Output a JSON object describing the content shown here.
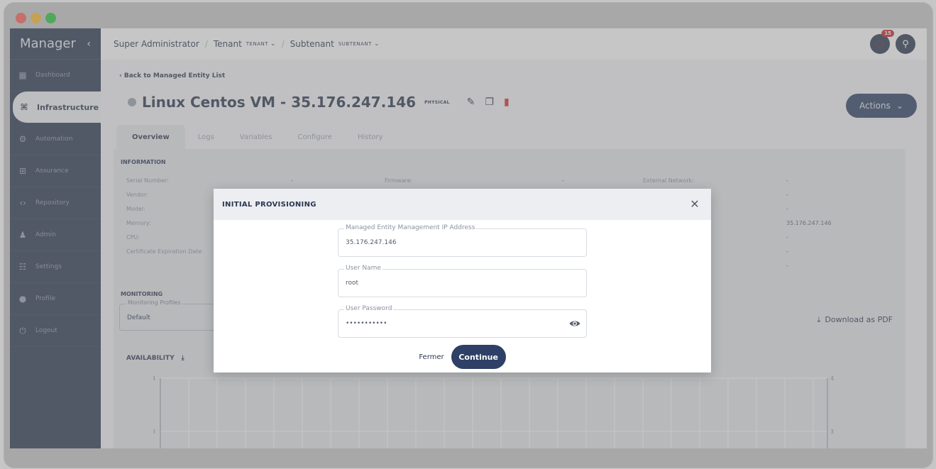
{
  "sidebar": {
    "brand": "Manager",
    "collapse_icon": "chevron-left-icon",
    "items": [
      {
        "label": "Dashboard",
        "icon": "grid-icon"
      },
      {
        "label": "Infrastructure",
        "icon": "network-icon",
        "active": true
      },
      {
        "label": "Automation",
        "icon": "gear-icon"
      },
      {
        "label": "Assurance",
        "icon": "table-icon"
      },
      {
        "label": "Repository",
        "icon": "code-icon"
      },
      {
        "label": "Admin",
        "icon": "user-icon"
      },
      {
        "label": "Settings",
        "icon": "sliders-icon"
      },
      {
        "label": "Profile",
        "icon": "profile-icon"
      },
      {
        "label": "Logout",
        "icon": "power-icon"
      }
    ]
  },
  "topbar": {
    "crumb1": "Super Administrator",
    "crumb2": "Tenant",
    "crumb2_tag": "TENANT",
    "crumb3": "Subtenant",
    "crumb3_tag": "SUBTENANT",
    "notif_count": "15"
  },
  "page": {
    "back_link": "Back to Managed Entity List",
    "title": "Linux Centos VM - 35.176.247.146",
    "type_tag": "PHYSICAL",
    "actions_label": "Actions",
    "tabs": [
      "Overview",
      "Logs",
      "Variables",
      "Configure",
      "History"
    ],
    "information_title": "INFORMATION",
    "info_labels_col1": [
      "Serial Number:",
      "Vendor:",
      "Model:",
      "Memory:",
      "CPU:",
      "Certificate Expiration Date"
    ],
    "serial_value": "-",
    "firmware_label": "Firmware:",
    "firmware_value": "-",
    "external_network_label": "External Network:",
    "col3_values": [
      "-",
      "-",
      "-",
      "35.176.247.146",
      "-",
      "-",
      "-"
    ],
    "monitoring_title": "MONITORING",
    "monitoring_profiles_label": "Monitoring Profiles",
    "monitoring_profiles_value": "Default",
    "download_pdf": "Download as PDF",
    "availability_label": "AVAILABILITY",
    "chart_ticks": [
      "4",
      "3"
    ]
  },
  "modal": {
    "title": "INITIAL PROVISIONING",
    "ip_label": "Managed Entity Management IP Address",
    "ip_value": "35.176.247.146",
    "username_label": "User Name",
    "username_value": "root",
    "password_label": "User Password",
    "password_value": "•••••••••••",
    "cancel_label": "Fermer",
    "continue_label": "Continue"
  }
}
